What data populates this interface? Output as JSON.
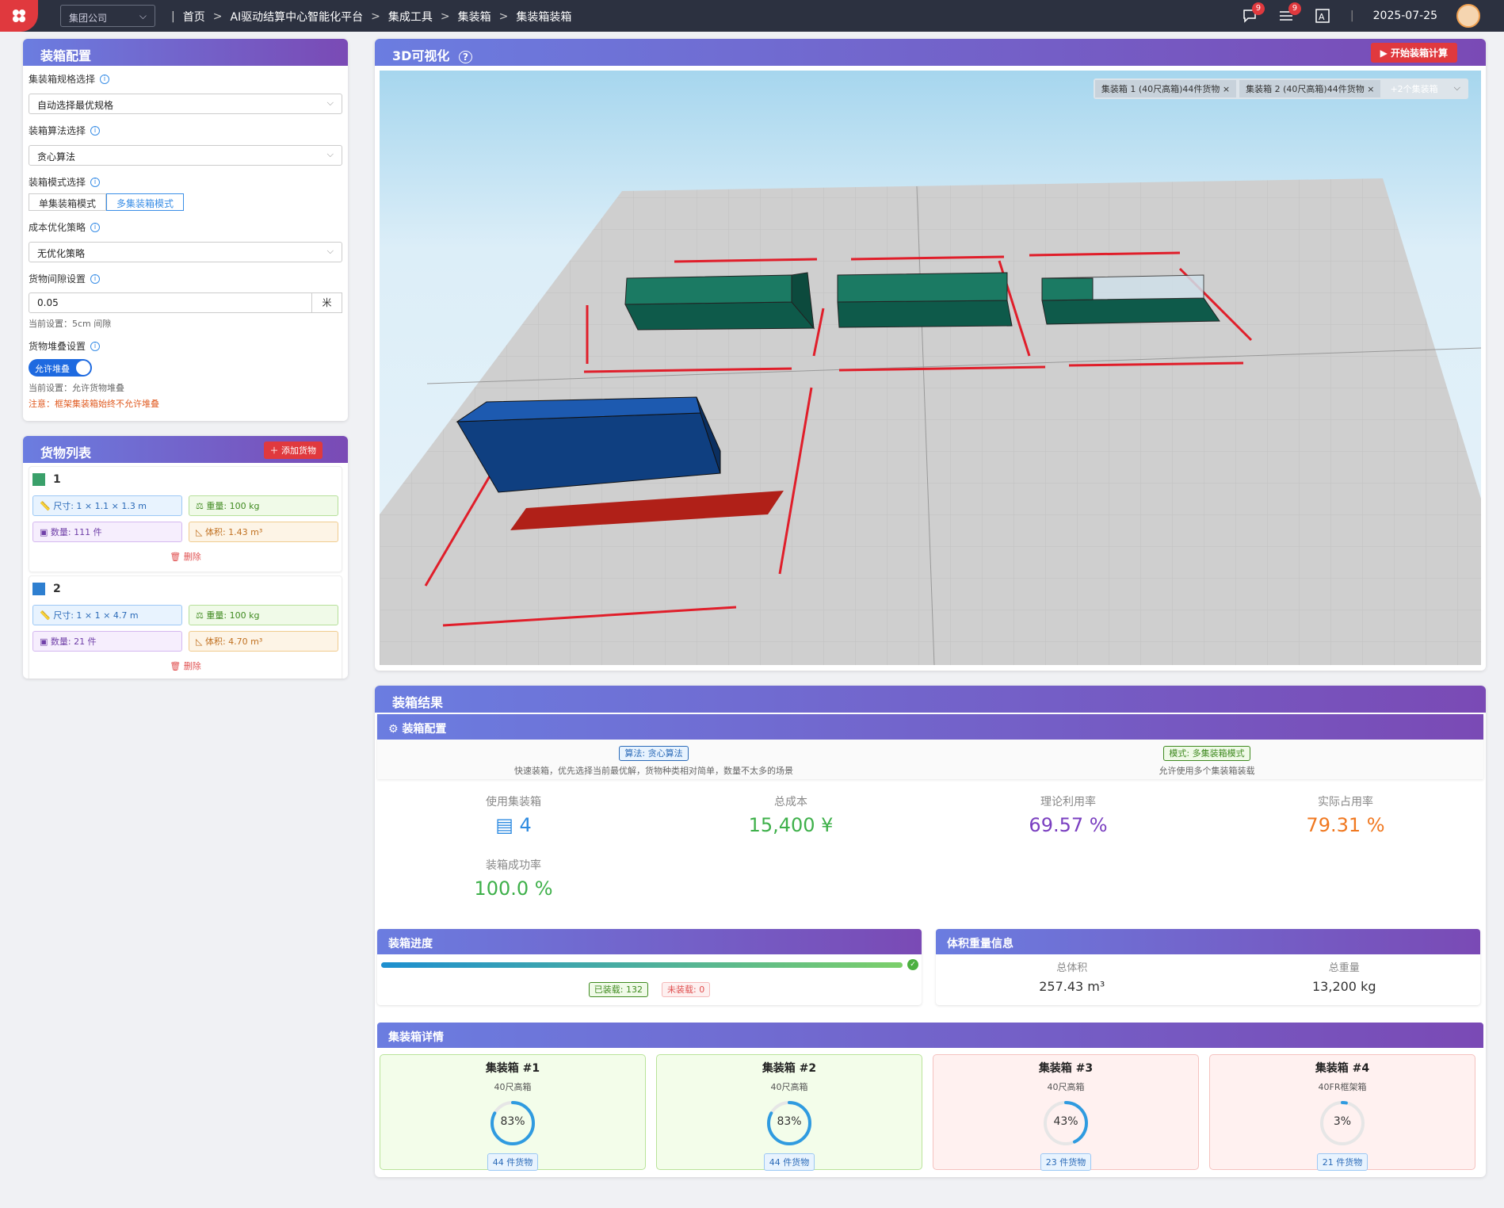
{
  "topbar": {
    "company": "集团公司",
    "crumbs": [
      "首页",
      "AI驱动结算中心智能化平台",
      "集成工具",
      "集装箱",
      "集装箱装箱"
    ],
    "badges": {
      "chat": "9",
      "list": "9"
    },
    "date": "2025-07-25"
  },
  "config": {
    "title": "装箱配置",
    "spec_label": "集装箱规格选择",
    "spec_value": "自动选择最优规格",
    "algo_label": "装箱算法选择",
    "algo_value": "贪心算法",
    "mode_label": "装箱模式选择",
    "mode_single": "单集装箱模式",
    "mode_multi": "多集装箱模式",
    "cost_label": "成本优化策略",
    "cost_value": "无优化策略",
    "gap_label": "货物间隙设置",
    "gap_value": "0.05",
    "gap_unit": "米",
    "gap_hint": "当前设置：5cm 间隙",
    "stack_label": "货物堆叠设置",
    "stack_toggle": "允许堆叠",
    "stack_hint": "当前设置：允许货物堆叠",
    "stack_warn": "注意：框架集装箱始终不允许堆叠"
  },
  "cargo": {
    "title": "货物列表",
    "add": "添加货物",
    "items": [
      {
        "name": "1",
        "color": "#3aa06a",
        "size": "尺寸: 1 × 1.1 × 1.3 m",
        "weight": "重量: 100 kg",
        "qty": "数量: 111 件",
        "vol": "体积: 1.43 m³",
        "del": "删除"
      },
      {
        "name": "2",
        "color": "#2e7fd0",
        "size": "尺寸: 1 × 1 × 4.7 m",
        "weight": "重量: 100 kg",
        "qty": "数量: 21 件",
        "vol": "体积: 4.70 m³",
        "del": "删除"
      }
    ]
  },
  "viz": {
    "title": "3D可视化",
    "start": "开始装箱计算",
    "tabs": [
      "集装箱 1 (40尺高箱)44件货物",
      "集装箱 2 (40尺高箱)44件货物",
      "+2个集装箱"
    ]
  },
  "result": {
    "title": "装箱结果",
    "cfg_title": "装箱配置",
    "algo_tag": "算法: 贪心算法",
    "algo_desc": "快速装箱，优先选择当前最优解，货物种类相对简单，数量不太多的场景",
    "mode_tag": "模式: 多集装箱模式",
    "mode_desc": "允许使用多个集装箱装载",
    "stats": [
      {
        "label": "使用集装箱",
        "value": "4",
        "color": "#2e8be0"
      },
      {
        "label": "总成本",
        "value": "15,400 ¥",
        "color": "#3eb04a"
      },
      {
        "label": "理论利用率",
        "value": "69.57 %",
        "color": "#7a3fc0"
      },
      {
        "label": "实际占用率",
        "value": "79.31 %",
        "color": "#f07820"
      },
      {
        "label": "装箱成功率",
        "value": "100.0 %",
        "color": "#3eb04a"
      }
    ],
    "progress_title": "装箱进度",
    "progress": 1.0,
    "loaded": "已装载: 132",
    "unloaded": "未装载: 0",
    "vw_title": "体积重量信息",
    "total_vol_label": "总体积",
    "total_vol": "257.43 m³",
    "total_wt_label": "总重量",
    "total_wt": "13,200 kg",
    "detail_title": "集装箱详情",
    "containers": [
      {
        "title": "集装箱 #1",
        "type": "40尺高箱",
        "pct": "83%",
        "frac": 0.83,
        "count": "44 件货物",
        "tone": "green"
      },
      {
        "title": "集装箱 #2",
        "type": "40尺高箱",
        "pct": "83%",
        "frac": 0.83,
        "count": "44 件货物",
        "tone": "green"
      },
      {
        "title": "集装箱 #3",
        "type": "40尺高箱",
        "pct": "43%",
        "frac": 0.43,
        "count": "23 件货物",
        "tone": "red"
      },
      {
        "title": "集装箱 #4",
        "type": "40FR框架箱",
        "pct": "3%",
        "frac": 0.03,
        "count": "21 件货物",
        "tone": "red"
      }
    ]
  }
}
